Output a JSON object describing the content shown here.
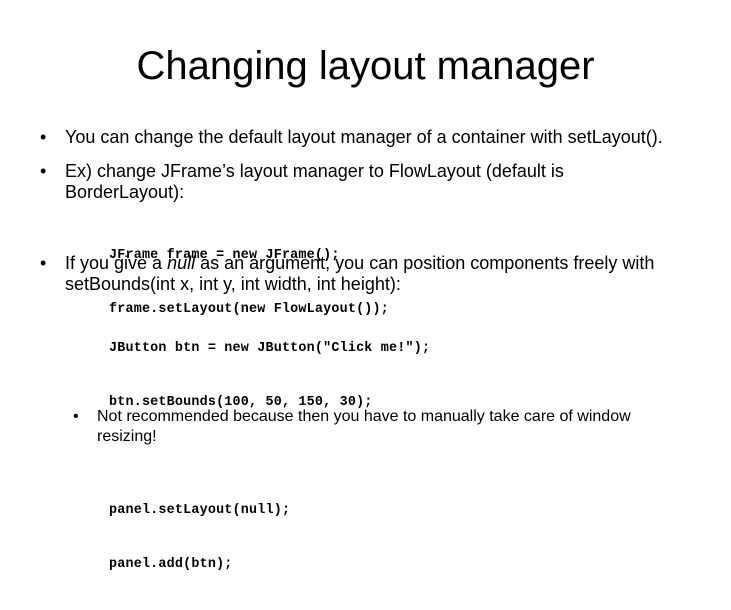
{
  "slide": {
    "title": "Changing layout manager",
    "bullets": [
      {
        "marker": "•",
        "text": "You can change the default layout manager of a container with setLayout()."
      },
      {
        "marker": "•",
        "text": "Ex) change JFrame’s layout manager to FlowLayout (default is BorderLayout):"
      },
      {
        "marker": "•",
        "text_before": "If you give a ",
        "emphasis": "null",
        "text_after": " as an argument, you can position components freely with setBounds(int x, int y, int width, int height):"
      }
    ],
    "code_block_1": [
      "JFrame frame = new JFrame();",
      "frame.setLayout(new FlowLayout());"
    ],
    "code_block_2": [
      "JButton btn = new JButton(\"Click me!\");",
      "btn.setBounds(100, 50, 150, 30);",
      "",
      "panel.setLayout(null);",
      "panel.add(btn);"
    ],
    "sub_bullet": {
      "marker": "•",
      "text": "Not recommended because then you have to manually take care of window resizing!"
    }
  }
}
